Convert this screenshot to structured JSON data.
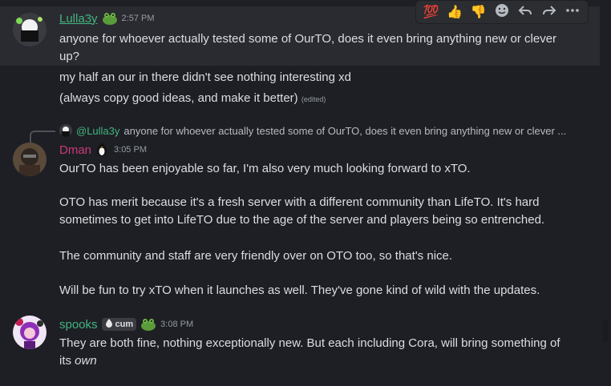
{
  "toolbar": {
    "reactions": [
      "💯",
      "👍",
      "👎"
    ],
    "actions": [
      "add-reaction",
      "reply",
      "forward",
      "more"
    ]
  },
  "messages": [
    {
      "username": "Lulla3y",
      "username_color": "#43b581",
      "timestamp": "2:57 PM",
      "lines": [
        "anyone for whoever actually tested some of OurTO, does it even bring anything new or clever",
        "up?",
        "my half an our in there didn't see nothing interesting xd",
        "(always copy good ideas, and make it better)"
      ],
      "edited_label": "(edited)"
    },
    {
      "reply_to": "@Lulla3y",
      "reply_preview": "anyone for whoever actually tested some of OurTO, does it even bring anything new or clever ...",
      "username": "Dman",
      "username_color": "#c93a7b",
      "timestamp": "3:05 PM",
      "lines": [
        "OurTO has been enjoyable so far, I'm also very much looking forward to xTO.",
        "OTO has merit because it's a fresh server with a different community than LifeTO. It's hard",
        "sometimes to get into LifeTO due to the age of the server and players being so entrenched.",
        "The community and staff are very friendly over on OTO too, so that's nice.",
        "Will be fun to try xTO when it launches as well. They've gone kind of wild with the updates."
      ]
    },
    {
      "username": "spooks",
      "username_color": "#43b581",
      "role_tag": "cum",
      "timestamp": "3:08 PM",
      "lines": [
        "They are both fine, nothing exceptionally new. But each including Cora, will bring something of",
        "its ",
        "own"
      ]
    }
  ]
}
